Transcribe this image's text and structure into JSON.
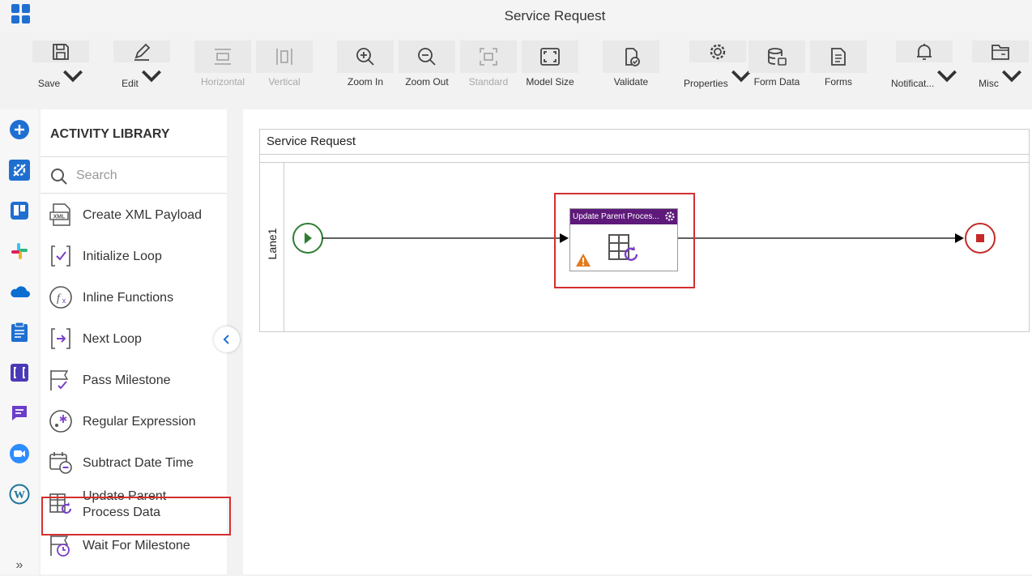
{
  "app": {
    "title": "Service Request"
  },
  "toolbar": [
    {
      "name": "save",
      "label": "Save",
      "icon": "save-icon",
      "caret": true,
      "disabled": false
    },
    {
      "name": "edit",
      "label": "Edit",
      "icon": "pencil-icon",
      "caret": true,
      "disabled": false
    },
    {
      "name": "horizontal",
      "label": "Horizontal",
      "icon": "horizontal-icon",
      "caret": false,
      "disabled": true
    },
    {
      "name": "vertical",
      "label": "Vertical",
      "icon": "vertical-icon",
      "caret": false,
      "disabled": true
    },
    {
      "name": "zoom-in",
      "label": "Zoom In",
      "icon": "zoom-in-icon",
      "caret": false,
      "disabled": false
    },
    {
      "name": "zoom-out",
      "label": "Zoom Out",
      "icon": "zoom-out-icon",
      "caret": false,
      "disabled": false
    },
    {
      "name": "standard",
      "label": "Standard",
      "icon": "standard-icon",
      "caret": false,
      "disabled": true
    },
    {
      "name": "model-size",
      "label": "Model Size",
      "icon": "model-size-icon",
      "caret": false,
      "disabled": false
    },
    {
      "name": "validate",
      "label": "Validate",
      "icon": "validate-icon",
      "caret": false,
      "disabled": false
    },
    {
      "name": "properties",
      "label": "Properties",
      "icon": "gear-icon",
      "caret": true,
      "disabled": false
    },
    {
      "name": "form-data",
      "label": "Form Data",
      "icon": "database-icon",
      "caret": false,
      "disabled": false
    },
    {
      "name": "forms",
      "label": "Forms",
      "icon": "forms-icon",
      "caret": false,
      "disabled": false
    },
    {
      "name": "notifications",
      "label": "Notificat...",
      "icon": "bell-icon",
      "caret": true,
      "disabled": false
    },
    {
      "name": "misc",
      "label": "Misc",
      "icon": "folder-icon",
      "caret": true,
      "disabled": false
    }
  ],
  "library": {
    "title": "ACTIVITY LIBRARY",
    "search_placeholder": "Search",
    "items": [
      {
        "label": "Create XML Payload",
        "icon": "xml-icon"
      },
      {
        "label": "Initialize Loop",
        "icon": "initialize-loop-icon"
      },
      {
        "label": "Inline Functions",
        "icon": "function-icon"
      },
      {
        "label": "Next Loop",
        "icon": "next-loop-icon"
      },
      {
        "label": "Pass Milestone",
        "icon": "milestone-icon"
      },
      {
        "label": "Regular Expression",
        "icon": "regex-icon"
      },
      {
        "label": "Subtract Date Time",
        "icon": "calendar-minus-icon"
      },
      {
        "label": "Update Parent Process Data",
        "icon": "update-parent-icon"
      },
      {
        "label": "Wait For Milestone",
        "icon": "wait-milestone-icon"
      }
    ]
  },
  "canvas": {
    "pool_title": "Service Request",
    "lane_label": "Lane1",
    "task_title": "Update Parent Proces...",
    "task_warning": true
  },
  "colors": {
    "accent": "#1f6fd1",
    "task_header": "#5e1a7a",
    "start": "#2e7d32",
    "end": "#c62828",
    "highlight": "#d32f2f"
  }
}
